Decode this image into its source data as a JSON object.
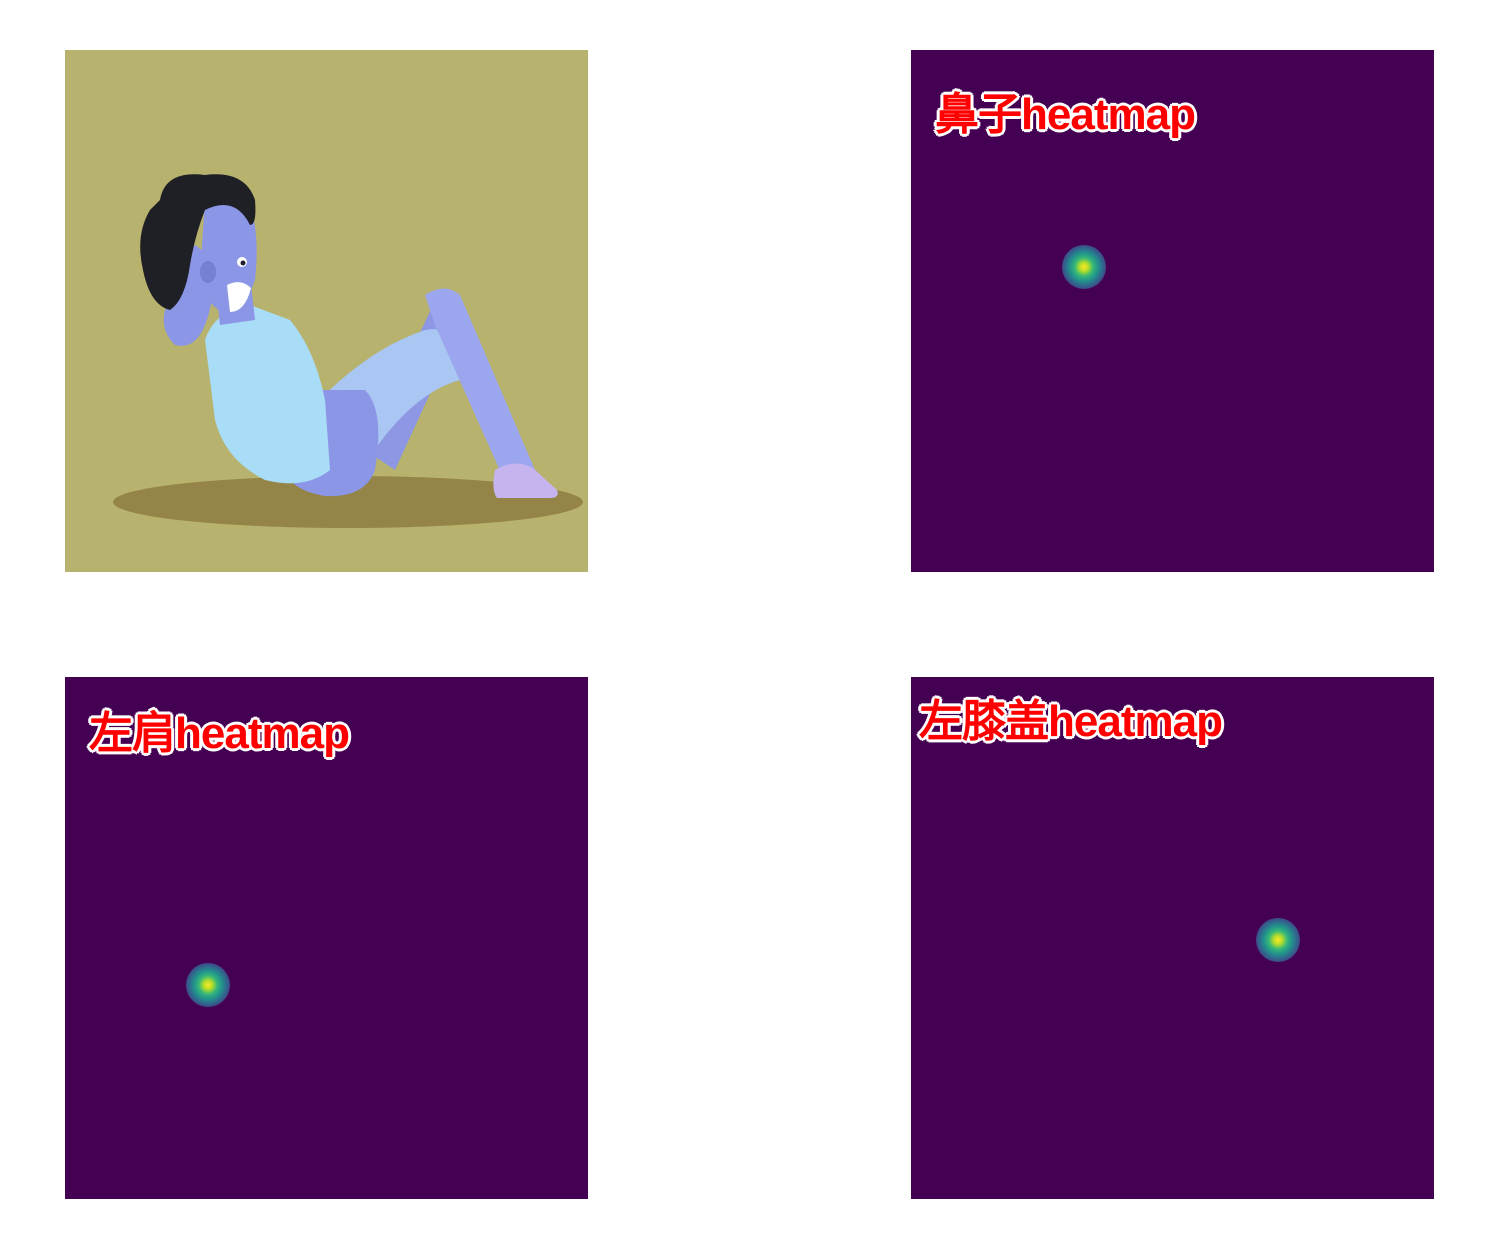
{
  "panels": {
    "illustration": {
      "background": "#b7b26d"
    },
    "nose": {
      "label": "鼻子heatmap",
      "background": "#440154"
    },
    "shoulder": {
      "label": "左肩heatmap",
      "background": "#440154"
    },
    "knee": {
      "label": "左膝盖heatmap",
      "background": "#440154"
    }
  },
  "colors": {
    "label_text": "#ff0000",
    "label_outline": "#ffffff",
    "heatmap_low": "#440154",
    "heatmap_high": "#fde725"
  }
}
